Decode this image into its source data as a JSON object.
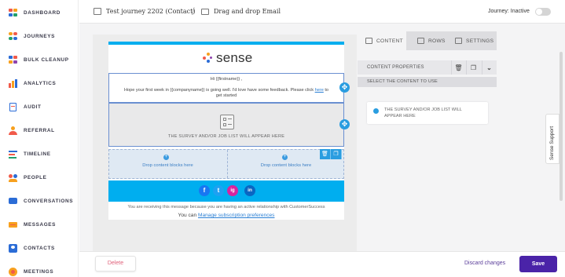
{
  "sidebar": {
    "items": [
      {
        "label": "DASHBOARD",
        "icon": "dashboard-icon"
      },
      {
        "label": "JOURNEYS",
        "icon": "journeys-icon"
      },
      {
        "label": "BULK CLEANUP",
        "icon": "bulk-cleanup-icon"
      },
      {
        "label": "ANALYTICS",
        "icon": "analytics-icon"
      },
      {
        "label": "AUDIT",
        "icon": "audit-icon"
      },
      {
        "label": "REFERRAL",
        "icon": "referral-icon"
      },
      {
        "label": "TIMELINE",
        "icon": "timeline-icon"
      },
      {
        "label": "PEOPLE",
        "icon": "people-icon"
      },
      {
        "label": "CONVERSATIONS",
        "icon": "conversations-icon"
      },
      {
        "label": "MESSAGES",
        "icon": "messages-icon"
      },
      {
        "label": "CONTACTS",
        "icon": "contacts-icon"
      },
      {
        "label": "MEETINGS",
        "icon": "meetings-icon"
      }
    ]
  },
  "header": {
    "journey_title": "Test journey 2202 (Contact)",
    "separator": "/",
    "email_title": "Drag and drop Email",
    "journey_status": "Journey: Inactive",
    "toggle_on": false
  },
  "email": {
    "logo_text": "sense",
    "greeting": "Hi {{firstname}}  ,",
    "body_line1_a": "Hope your first week in {{companyname}}  is going well. I'd love have some feedback. Please click",
    "body_link": "here",
    "body_line1_b": "to",
    "body_line2": "get started",
    "survey_placeholder": "THE SURVEY AND/OR JOB LIST WILL APPEAR HERE",
    "drop_left": "Drop content blocks here",
    "drop_right": "Drop content blocks here",
    "social": [
      "f",
      "t",
      "ig",
      "in"
    ],
    "footer_line": "You are receiving this message because you are having an active relationship with CustomerSuccess",
    "footer_you_can": "You can",
    "footer_link": "Manage subscription preferences"
  },
  "right_panel": {
    "tabs": [
      {
        "label": "CONTENT",
        "active": true
      },
      {
        "label": "ROWS",
        "active": false
      },
      {
        "label": "SETTINGS",
        "active": false
      }
    ],
    "props_title": "CONTENT PROPERTIES",
    "select_label": "SELECT THE CONTENT TO USE",
    "content_option": "THE SURVEY AND/OR JOB LIST WILL APPEAR HERE"
  },
  "support_tab": "Sense Support",
  "footer": {
    "delete_label": "Delete",
    "discard_label": "Discard changes",
    "save_label": "Save"
  },
  "colors": {
    "accent_blue": "#00aeef",
    "save_purple": "#4a23a8",
    "delete_red": "#e0607a",
    "select_blue": "#2a9de0"
  }
}
